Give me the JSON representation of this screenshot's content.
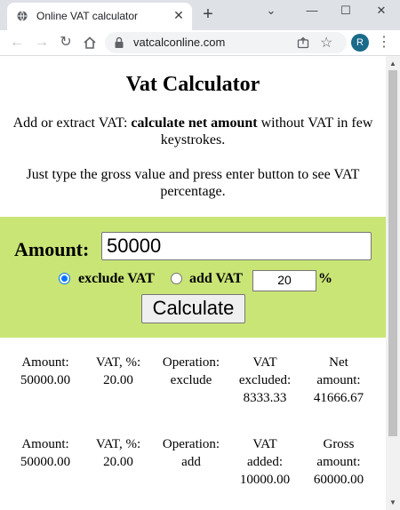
{
  "browser": {
    "tab_title": "Online VAT calculator",
    "tab_close": "✕",
    "new_tab": "+",
    "url": "vatcalconline.com",
    "avatar_letter": "R",
    "window_controls": {
      "minimize": "—",
      "maximize": "☐",
      "close": "✕",
      "dropdown": "⌄"
    }
  },
  "page": {
    "title": "Vat Calculator",
    "intro_prefix": "Add or extract VAT: ",
    "intro_bold": "calculate net amount",
    "intro_suffix": " without VAT in few keystrokes.",
    "hint": "Just type the gross value and press enter button to see VAT percentage."
  },
  "form": {
    "amount_label": "Amount:",
    "amount_value": "50000",
    "option_exclude": "exclude VAT",
    "option_add": "add VAT",
    "selected_option": "exclude VAT",
    "rate_value": "20",
    "percent_sign": "%",
    "calculate_label": "Calculate",
    "background_color": "#c9e576"
  },
  "results": [
    {
      "amount_label": "Amount:",
      "amount": "50000.00",
      "vat_label": "VAT, %:",
      "vat": "20.00",
      "operation_label": "Operation:",
      "operation": "exclude",
      "vat_amount_label_1": "VAT",
      "vat_amount_label_2": "excluded:",
      "vat_amount": "8333.33",
      "total_label_1": "Net",
      "total_label_2": "amount:",
      "total": "41666.67"
    },
    {
      "amount_label": "Amount:",
      "amount": "50000.00",
      "vat_label": "VAT, %:",
      "vat": "20.00",
      "operation_label": "Operation:",
      "operation": "add",
      "vat_amount_label_1": "VAT",
      "vat_amount_label_2": "added:",
      "vat_amount": "10000.00",
      "total_label_1": "Gross",
      "total_label_2": "amount:",
      "total": "60000.00"
    }
  ]
}
